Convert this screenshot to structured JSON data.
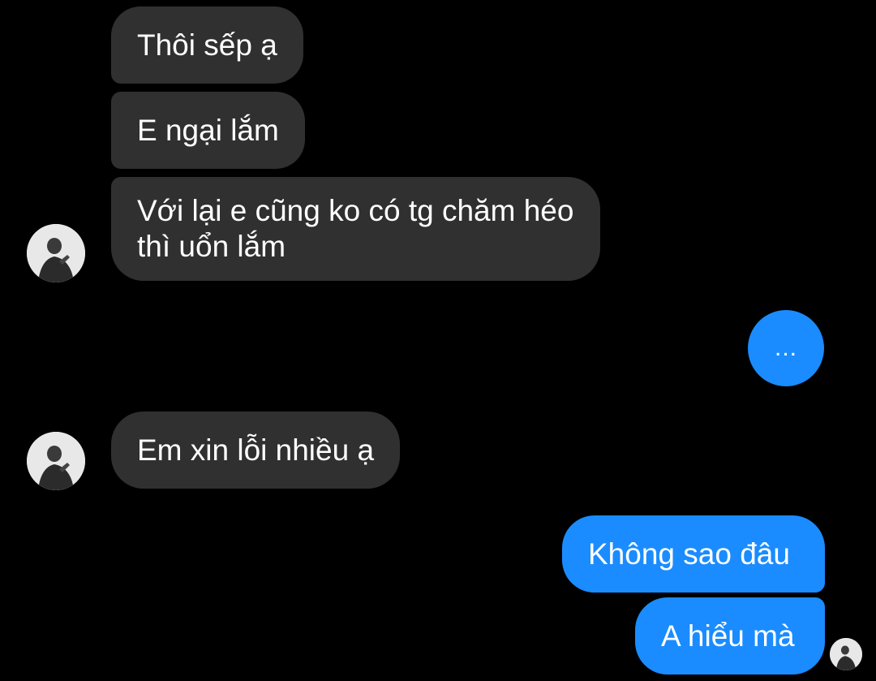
{
  "conversation": {
    "incoming_messages": [
      {
        "text": "Thôi sếp ạ"
      },
      {
        "text": "E ngại lắm"
      },
      {
        "text": "Với lại e cũng ko có tg chăm héo thì uổn lắm"
      },
      {
        "text": "Em xin lỗi nhiều ạ"
      }
    ],
    "typing_indicator": {
      "text": "..."
    },
    "outgoing_messages": [
      {
        "text": "Không sao đâu"
      },
      {
        "text": "A hiểu mà"
      }
    ]
  },
  "avatars": {
    "contact": "contact-avatar-icon",
    "read_receipt": "read-receipt-avatar-icon"
  },
  "colors": {
    "background": "#000000",
    "incoming_bubble": "#303030",
    "outgoing_bubble": "#1a8cff",
    "text": "#ffffff"
  }
}
